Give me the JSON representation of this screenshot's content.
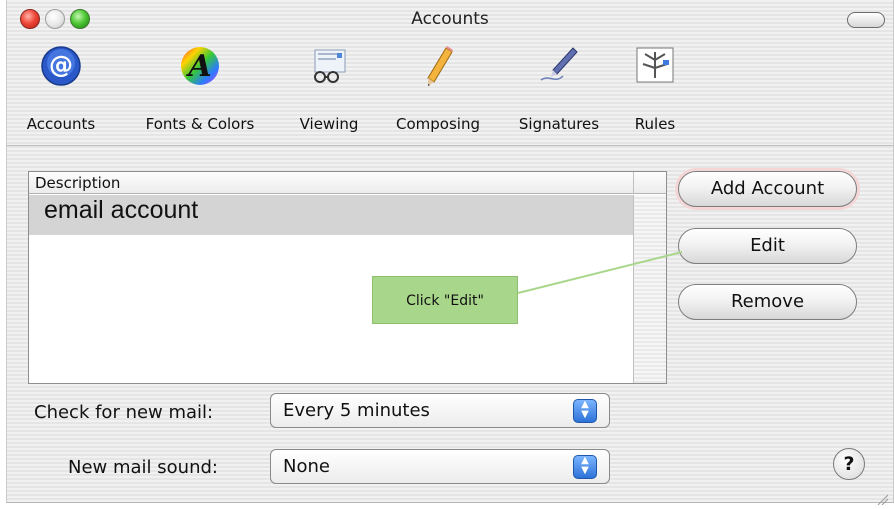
{
  "window": {
    "title": "Accounts"
  },
  "toolbar": {
    "items": [
      {
        "label": "Accounts",
        "icon": "at-sign-icon"
      },
      {
        "label": "Fonts & Colors",
        "icon": "font-color-icon"
      },
      {
        "label": "Viewing",
        "icon": "glasses-icon"
      },
      {
        "label": "Composing",
        "icon": "pencil-icon"
      },
      {
        "label": "Signatures",
        "icon": "pen-icon"
      },
      {
        "label": "Rules",
        "icon": "rules-icon"
      }
    ]
  },
  "accounts_list": {
    "header": "Description",
    "rows": [
      "email account"
    ],
    "selected_index": 0
  },
  "buttons": {
    "add": "Add Account",
    "edit": "Edit",
    "remove": "Remove"
  },
  "callout": {
    "text": "Click \"Edit\"",
    "color": "#a8d68b"
  },
  "settings": {
    "check_label": "Check for new mail:",
    "check_value": "Every 5 minutes",
    "sound_label": "New mail sound:",
    "sound_value": "None"
  },
  "help": {
    "text": "?"
  },
  "colors": {
    "accent_blue": "#2d72d8",
    "selection": "#d4d4d4"
  }
}
